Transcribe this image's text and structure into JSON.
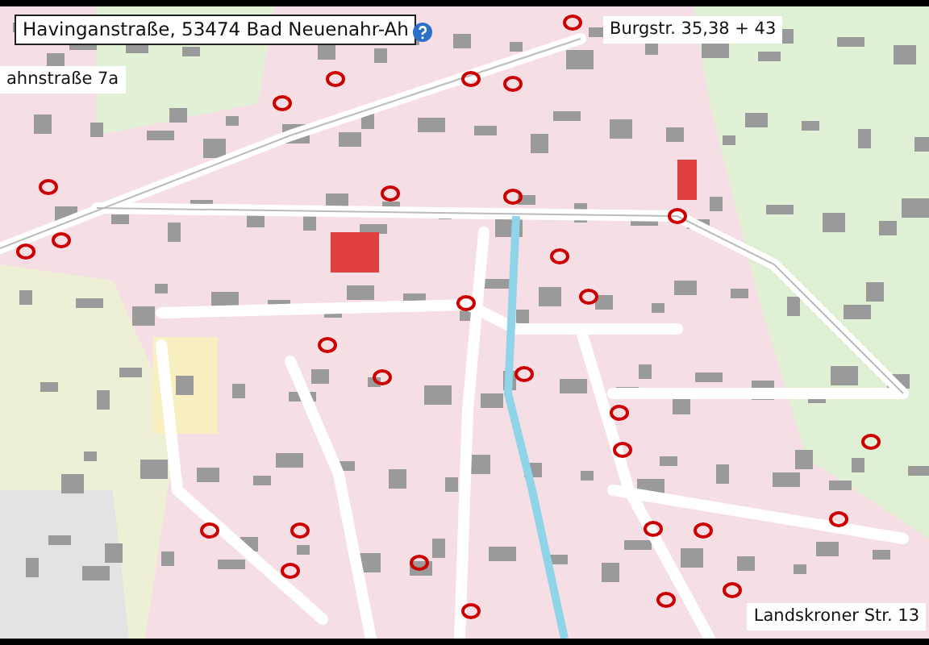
{
  "map": {
    "labels": [
      {
        "text": "Havinganstraße, 53474 Bad Neuenahr-Ah",
        "kind": "framed"
      },
      {
        "text": "ahnstraße 7a",
        "kind": "plain"
      },
      {
        "text": "Burgstr. 35,38 + 43",
        "kind": "plain"
      },
      {
        "text": "Landskroner Str. 13",
        "kind": "plain"
      }
    ]
  }
}
